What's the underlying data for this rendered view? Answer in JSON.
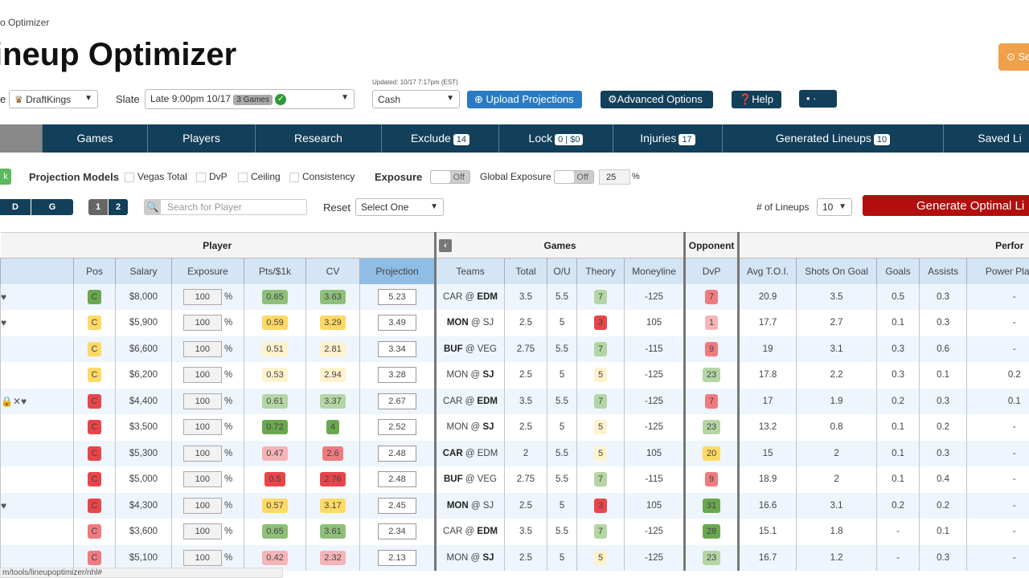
{
  "breadcrumb": "o Optimizer",
  "title": "ineup Optimizer",
  "top_right_button": "Se",
  "site_label": "e",
  "site_select": "DraftKings",
  "slate_label": "Slate",
  "slate_select": "Late 9:00pm 10/17",
  "slate_games": "3 Games",
  "updated": "Updated: 10/17 7:17pm (EST)",
  "mode_select": "Cash",
  "buttons": {
    "upload": "Upload Projections",
    "advanced": "Advanced Options",
    "help": "Help",
    "dots": "• ·"
  },
  "nav": [
    {
      "label": "Games"
    },
    {
      "label": "Players"
    },
    {
      "label": "Research"
    },
    {
      "label": "Exclude",
      "badge": "14"
    },
    {
      "label": "Lock",
      "badge": "0 | $0"
    },
    {
      "label": "Injuries",
      "badge": "17"
    },
    {
      "label": "Generated Lineups",
      "badge": "10"
    },
    {
      "label": "Saved Li"
    }
  ],
  "options": {
    "green_stub": "k",
    "proj_models": "Projection Models",
    "models": [
      "Vegas Total",
      "DvP",
      "Ceiling",
      "Consistency"
    ],
    "exposure": "Exposure",
    "toggle_off": "Off",
    "global_exposure": "Global Exposure",
    "global_value": "25",
    "pct": "%"
  },
  "filters": {
    "positions": [
      "D",
      "G"
    ],
    "pages": [
      "1",
      "2"
    ],
    "search_placeholder": "Search for Player",
    "reset": "Reset",
    "reset_select": "Select One",
    "lineups_label": "# of Lineups",
    "lineups_value": "10",
    "generate": "Generate Optimal Li"
  },
  "groups": {
    "player": "Player",
    "games": "Games",
    "opponent": "Opponent",
    "perf": "Perfor"
  },
  "columns": [
    "",
    "Pos",
    "Salary",
    "Exposure",
    "Pts/$1k",
    "CV",
    "Projection",
    "Teams",
    "Total",
    "O/U",
    "Theory",
    "Moneyline",
    "DvP",
    "Avg T.O.I.",
    "Shots On Goal",
    "Goals",
    "Assists",
    "Power Play P"
  ],
  "colors": {
    "g2": "#6aa84f",
    "g1": "#8fc07a",
    "g0": "#b4d6a4",
    "y1": "#ffd966",
    "y0": "#fff2cc",
    "r0": "#f5b5b8",
    "r1": "#ef7b7f",
    "r2": "#e8454a"
  },
  "rows": [
    {
      "icons": "♥",
      "pos": "C",
      "posc": "g2",
      "salary": "$8,000",
      "exp": "100",
      "pts": "0.65",
      "ptsc": "g1",
      "cv": "3.63",
      "cvc": "g1",
      "proj": "5.23",
      "away": "CAR",
      "home": "EDM",
      "bold": "home",
      "total": "3.5",
      "ou": "5.5",
      "theory": "7",
      "thc": "g0",
      "ml": "-125",
      "dvp": "7",
      "dvpc": "r1",
      "toi": "20.9",
      "sog": "3.5",
      "goals": "0.5",
      "assists": "0.3",
      "ppp": "-"
    },
    {
      "icons": "♥",
      "pos": "C",
      "posc": "y1",
      "salary": "$5,900",
      "exp": "100",
      "pts": "0.59",
      "ptsc": "y1",
      "cv": "3.29",
      "cvc": "y1",
      "proj": "3.49",
      "away": "MON",
      "home": "SJ",
      "bold": "away",
      "total": "2.5",
      "ou": "5",
      "theory": "3",
      "thc": "r2",
      "ml": "105",
      "dvp": "1",
      "dvpc": "r0",
      "toi": "17.7",
      "sog": "2.7",
      "goals": "0.1",
      "assists": "0.3",
      "ppp": "-"
    },
    {
      "icons": "",
      "pos": "C",
      "posc": "y1",
      "salary": "$6,600",
      "exp": "100",
      "pts": "0.51",
      "ptsc": "y0",
      "cv": "2.81",
      "cvc": "y0",
      "proj": "3.34",
      "away": "BUF",
      "home": "VEG",
      "bold": "away",
      "total": "2.75",
      "ou": "5.5",
      "theory": "7",
      "thc": "g0",
      "ml": "-115",
      "dvp": "9",
      "dvpc": "r1",
      "toi": "19",
      "sog": "3.1",
      "goals": "0.3",
      "assists": "0.6",
      "ppp": "-"
    },
    {
      "icons": "",
      "pos": "C",
      "posc": "y1",
      "salary": "$6,200",
      "exp": "100",
      "pts": "0.53",
      "ptsc": "y0",
      "cv": "2.94",
      "cvc": "y0",
      "proj": "3.28",
      "away": "MON",
      "home": "SJ",
      "bold": "home",
      "total": "2.5",
      "ou": "5",
      "theory": "5",
      "thc": "y0",
      "ml": "-125",
      "dvp": "23",
      "dvpc": "g0",
      "toi": "17.8",
      "sog": "2.2",
      "goals": "0.3",
      "assists": "0.1",
      "ppp": "0.2"
    },
    {
      "icons": "🔒✕♥",
      "pos": "C",
      "posc": "r2",
      "salary": "$4,400",
      "exp": "100",
      "pts": "0.61",
      "ptsc": "g0",
      "cv": "3.37",
      "cvc": "g0",
      "proj": "2.67",
      "away": "CAR",
      "home": "EDM",
      "bold": "home",
      "total": "3.5",
      "ou": "5.5",
      "theory": "7",
      "thc": "g0",
      "ml": "-125",
      "dvp": "7",
      "dvpc": "r1",
      "toi": "17",
      "sog": "1.9",
      "goals": "0.2",
      "assists": "0.3",
      "ppp": "0.1"
    },
    {
      "icons": "",
      "pos": "C",
      "posc": "r2",
      "salary": "$3,500",
      "exp": "100",
      "pts": "0.72",
      "ptsc": "g2",
      "cv": "4",
      "cvc": "g2",
      "proj": "2.52",
      "away": "MON",
      "home": "SJ",
      "bold": "home",
      "total": "2.5",
      "ou": "5",
      "theory": "5",
      "thc": "y0",
      "ml": "-125",
      "dvp": "23",
      "dvpc": "g0",
      "toi": "13.2",
      "sog": "0.8",
      "goals": "0.1",
      "assists": "0.2",
      "ppp": "-"
    },
    {
      "icons": "",
      "pos": "C",
      "posc": "r2",
      "salary": "$5,300",
      "exp": "100",
      "pts": "0.47",
      "ptsc": "r0",
      "cv": "2.6",
      "cvc": "r1",
      "proj": "2.48",
      "away": "CAR",
      "home": "EDM",
      "bold": "away",
      "total": "2",
      "ou": "5.5",
      "theory": "5",
      "thc": "y0",
      "ml": "105",
      "dvp": "20",
      "dvpc": "y1",
      "toi": "15",
      "sog": "2",
      "goals": "0.1",
      "assists": "0.3",
      "ppp": "-"
    },
    {
      "icons": "",
      "pos": "C",
      "posc": "r2",
      "salary": "$5,000",
      "exp": "100",
      "pts": "0.5",
      "ptsc": "r2",
      "cv": "2.76",
      "cvc": "r2",
      "proj": "2.48",
      "away": "BUF",
      "home": "VEG",
      "bold": "away",
      "total": "2.75",
      "ou": "5.5",
      "theory": "7",
      "thc": "g0",
      "ml": "-115",
      "dvp": "9",
      "dvpc": "r1",
      "toi": "18.9",
      "sog": "2",
      "goals": "0.1",
      "assists": "0.4",
      "ppp": "-"
    },
    {
      "icons": "♥",
      "pos": "C",
      "posc": "r2",
      "salary": "$4,300",
      "exp": "100",
      "pts": "0.57",
      "ptsc": "y1",
      "cv": "3.17",
      "cvc": "y1",
      "proj": "2.45",
      "away": "MON",
      "home": "SJ",
      "bold": "away",
      "total": "2.5",
      "ou": "5",
      "theory": "3",
      "thc": "r2",
      "ml": "105",
      "dvp": "31",
      "dvpc": "g2",
      "toi": "16.6",
      "sog": "3.1",
      "goals": "0.2",
      "assists": "0.2",
      "ppp": "-"
    },
    {
      "icons": "",
      "pos": "C",
      "posc": "r1",
      "salary": "$3,600",
      "exp": "100",
      "pts": "0.65",
      "ptsc": "g1",
      "cv": "3.61",
      "cvc": "g1",
      "proj": "2.34",
      "away": "CAR",
      "home": "EDM",
      "bold": "home",
      "total": "3.5",
      "ou": "5.5",
      "theory": "7",
      "thc": "g0",
      "ml": "-125",
      "dvp": "28",
      "dvpc": "g2",
      "toi": "15.1",
      "sog": "1.8",
      "goals": "-",
      "assists": "0.1",
      "ppp": "-"
    },
    {
      "icons": "",
      "pos": "C",
      "posc": "r1",
      "salary": "$5,100",
      "exp": "100",
      "pts": "0.42",
      "ptsc": "r0",
      "cv": "2.32",
      "cvc": "r0",
      "proj": "2.13",
      "away": "MON",
      "home": "SJ",
      "bold": "home",
      "total": "2.5",
      "ou": "5",
      "theory": "5",
      "thc": "y0",
      "ml": "-125",
      "dvp": "23",
      "dvpc": "g0",
      "toi": "16.7",
      "sog": "1.2",
      "goals": "-",
      "assists": "0.3",
      "ppp": "-"
    }
  ],
  "status_url": "m/tools/lineupoptimizer/nhl#"
}
